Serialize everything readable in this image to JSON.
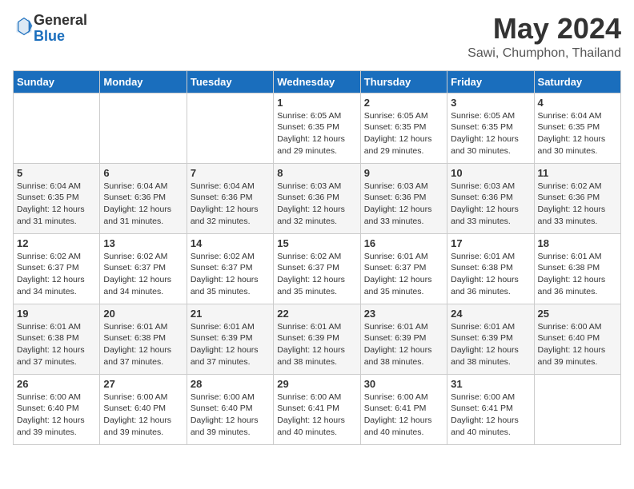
{
  "header": {
    "logo_general": "General",
    "logo_blue": "Blue",
    "month_year": "May 2024",
    "location": "Sawi, Chumphon, Thailand"
  },
  "weekdays": [
    "Sunday",
    "Monday",
    "Tuesday",
    "Wednesday",
    "Thursday",
    "Friday",
    "Saturday"
  ],
  "weeks": [
    [
      {
        "day": "",
        "info": ""
      },
      {
        "day": "",
        "info": ""
      },
      {
        "day": "",
        "info": ""
      },
      {
        "day": "1",
        "info": "Sunrise: 6:05 AM\nSunset: 6:35 PM\nDaylight: 12 hours\nand 29 minutes."
      },
      {
        "day": "2",
        "info": "Sunrise: 6:05 AM\nSunset: 6:35 PM\nDaylight: 12 hours\nand 29 minutes."
      },
      {
        "day": "3",
        "info": "Sunrise: 6:05 AM\nSunset: 6:35 PM\nDaylight: 12 hours\nand 30 minutes."
      },
      {
        "day": "4",
        "info": "Sunrise: 6:04 AM\nSunset: 6:35 PM\nDaylight: 12 hours\nand 30 minutes."
      }
    ],
    [
      {
        "day": "5",
        "info": "Sunrise: 6:04 AM\nSunset: 6:35 PM\nDaylight: 12 hours\nand 31 minutes."
      },
      {
        "day": "6",
        "info": "Sunrise: 6:04 AM\nSunset: 6:36 PM\nDaylight: 12 hours\nand 31 minutes."
      },
      {
        "day": "7",
        "info": "Sunrise: 6:04 AM\nSunset: 6:36 PM\nDaylight: 12 hours\nand 32 minutes."
      },
      {
        "day": "8",
        "info": "Sunrise: 6:03 AM\nSunset: 6:36 PM\nDaylight: 12 hours\nand 32 minutes."
      },
      {
        "day": "9",
        "info": "Sunrise: 6:03 AM\nSunset: 6:36 PM\nDaylight: 12 hours\nand 33 minutes."
      },
      {
        "day": "10",
        "info": "Sunrise: 6:03 AM\nSunset: 6:36 PM\nDaylight: 12 hours\nand 33 minutes."
      },
      {
        "day": "11",
        "info": "Sunrise: 6:02 AM\nSunset: 6:36 PM\nDaylight: 12 hours\nand 33 minutes."
      }
    ],
    [
      {
        "day": "12",
        "info": "Sunrise: 6:02 AM\nSunset: 6:37 PM\nDaylight: 12 hours\nand 34 minutes."
      },
      {
        "day": "13",
        "info": "Sunrise: 6:02 AM\nSunset: 6:37 PM\nDaylight: 12 hours\nand 34 minutes."
      },
      {
        "day": "14",
        "info": "Sunrise: 6:02 AM\nSunset: 6:37 PM\nDaylight: 12 hours\nand 35 minutes."
      },
      {
        "day": "15",
        "info": "Sunrise: 6:02 AM\nSunset: 6:37 PM\nDaylight: 12 hours\nand 35 minutes."
      },
      {
        "day": "16",
        "info": "Sunrise: 6:01 AM\nSunset: 6:37 PM\nDaylight: 12 hours\nand 35 minutes."
      },
      {
        "day": "17",
        "info": "Sunrise: 6:01 AM\nSunset: 6:38 PM\nDaylight: 12 hours\nand 36 minutes."
      },
      {
        "day": "18",
        "info": "Sunrise: 6:01 AM\nSunset: 6:38 PM\nDaylight: 12 hours\nand 36 minutes."
      }
    ],
    [
      {
        "day": "19",
        "info": "Sunrise: 6:01 AM\nSunset: 6:38 PM\nDaylight: 12 hours\nand 37 minutes."
      },
      {
        "day": "20",
        "info": "Sunrise: 6:01 AM\nSunset: 6:38 PM\nDaylight: 12 hours\nand 37 minutes."
      },
      {
        "day": "21",
        "info": "Sunrise: 6:01 AM\nSunset: 6:39 PM\nDaylight: 12 hours\nand 37 minutes."
      },
      {
        "day": "22",
        "info": "Sunrise: 6:01 AM\nSunset: 6:39 PM\nDaylight: 12 hours\nand 38 minutes."
      },
      {
        "day": "23",
        "info": "Sunrise: 6:01 AM\nSunset: 6:39 PM\nDaylight: 12 hours\nand 38 minutes."
      },
      {
        "day": "24",
        "info": "Sunrise: 6:01 AM\nSunset: 6:39 PM\nDaylight: 12 hours\nand 38 minutes."
      },
      {
        "day": "25",
        "info": "Sunrise: 6:00 AM\nSunset: 6:40 PM\nDaylight: 12 hours\nand 39 minutes."
      }
    ],
    [
      {
        "day": "26",
        "info": "Sunrise: 6:00 AM\nSunset: 6:40 PM\nDaylight: 12 hours\nand 39 minutes."
      },
      {
        "day": "27",
        "info": "Sunrise: 6:00 AM\nSunset: 6:40 PM\nDaylight: 12 hours\nand 39 minutes."
      },
      {
        "day": "28",
        "info": "Sunrise: 6:00 AM\nSunset: 6:40 PM\nDaylight: 12 hours\nand 39 minutes."
      },
      {
        "day": "29",
        "info": "Sunrise: 6:00 AM\nSunset: 6:41 PM\nDaylight: 12 hours\nand 40 minutes."
      },
      {
        "day": "30",
        "info": "Sunrise: 6:00 AM\nSunset: 6:41 PM\nDaylight: 12 hours\nand 40 minutes."
      },
      {
        "day": "31",
        "info": "Sunrise: 6:00 AM\nSunset: 6:41 PM\nDaylight: 12 hours\nand 40 minutes."
      },
      {
        "day": "",
        "info": ""
      }
    ]
  ]
}
